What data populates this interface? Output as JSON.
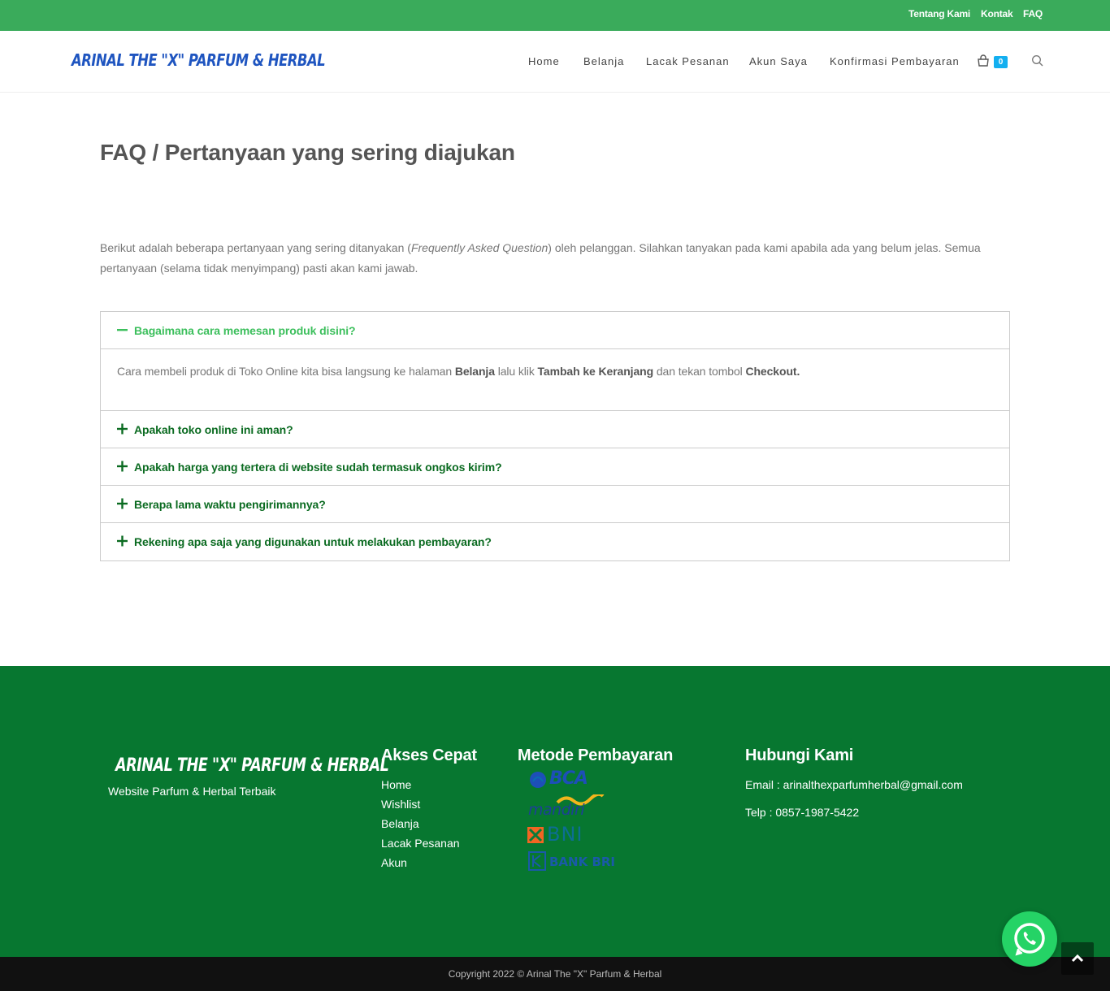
{
  "topbar": {
    "links": [
      "Tentang Kami",
      "Kontak",
      "FAQ"
    ]
  },
  "header": {
    "logo": "ARINAL THE \"X\" PARFUM & HERBAL",
    "nav": [
      "Home",
      "Belanja",
      "Lacak Pesanan",
      "Akun Saya",
      "Konfirmasi Pembayaran"
    ],
    "cart_count": "0",
    "icons": [
      "cart-icon",
      "search-icon"
    ]
  },
  "main": {
    "title": "FAQ / Pertanyaan yang sering diajukan",
    "intro_part1": "Berikut adalah beberapa pertanyaan yang sering ditanyakan (",
    "intro_em": "Frequently Asked Question",
    "intro_part2": ") oleh pelanggan. Silahkan tanyakan pada kami apabila ada yang belum jelas. Semua pertanyaan (selama tidak menyimpang) pasti akan kami jawab.",
    "faq": [
      {
        "question": "Bagaimana cara memesan produk disini?",
        "open": true,
        "answer_1": "Cara membeli produk di Toko Online kita bisa langsung ke halaman ",
        "answer_b1": "Belanja",
        "answer_2": " lalu klik ",
        "answer_b2": "Tambah ke Keranjang",
        "answer_3": " dan tekan tombol ",
        "answer_b3": "Checkout."
      },
      {
        "question": "Apakah toko online ini aman?",
        "open": false
      },
      {
        "question": "Apakah harga yang tertera di website sudah termasuk ongkos kirim?",
        "open": false
      },
      {
        "question": "Berapa lama waktu pengirimannya?",
        "open": false
      },
      {
        "question": "Rekening apa saja yang digunakan untuk melakukan pembayaran?",
        "open": false
      }
    ]
  },
  "footer": {
    "logo": "ARINAL THE \"X\" PARFUM & HERBAL",
    "tagline": "Website Parfum & Herbal Terbaik",
    "quick_title": "Akses Cepat",
    "quick_links": [
      "Home",
      "Wishlist",
      "Belanja",
      "Lacak Pesanan",
      "Akun"
    ],
    "pay_title": "Metode Pembayaran",
    "banks": [
      "BCA",
      "mandiri",
      "BNI",
      "BANK BRI"
    ],
    "contact_title": "Hubungi Kami",
    "email": "Email : arinalthexparfumherbal@gmail.com",
    "phone": "Telp : 0857-1987-5422",
    "copyright": "Copyright 2022 © Arinal The \"X\" Parfum & Herbal"
  },
  "colors": {
    "topbar": "#3aab5b",
    "footer": "#077730",
    "faq_question": "#0b6b21",
    "faq_open": "#3cbf5c",
    "logo": "#1f55c0",
    "whatsapp": "#25d366"
  }
}
